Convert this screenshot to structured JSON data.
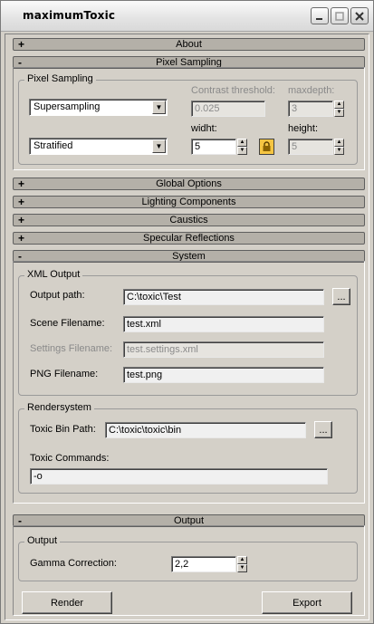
{
  "window": {
    "title": "maximumToxic"
  },
  "rollouts": {
    "about": {
      "sign": "+",
      "title": "About"
    },
    "pixel_sampling": {
      "sign": "-",
      "title": "Pixel Sampling"
    },
    "global_options": {
      "sign": "+",
      "title": "Global Options"
    },
    "lighting": {
      "sign": "+",
      "title": "Lighting Components"
    },
    "caustics": {
      "sign": "+",
      "title": "Caustics"
    },
    "specular": {
      "sign": "+",
      "title": "Specular Reflections"
    },
    "system": {
      "sign": "-",
      "title": "System"
    },
    "output": {
      "sign": "-",
      "title": "Output"
    }
  },
  "pixel_sampling": {
    "group": "Pixel Sampling",
    "sampling_mode": "Supersampling",
    "distribution": "Stratified",
    "contrast_label": "Contrast threshold:",
    "contrast_value": "0.025",
    "maxdepth_label": "maxdepth:",
    "maxdepth_value": "3",
    "width_label": "widht:",
    "width_value": "5",
    "height_label": "height:",
    "height_value": "5"
  },
  "xml_output": {
    "group": "XML Output",
    "output_path_label": "Output path:",
    "output_path": "C:\\toxic\\Test",
    "browse": "...",
    "scene_label": "Scene Filename:",
    "scene_value": "test.xml",
    "settings_label": "Settings Filename:",
    "settings_value": "test.settings.xml",
    "png_label": "PNG Filename:",
    "png_value": "test.png"
  },
  "rendersystem": {
    "group": "Rendersystem",
    "bin_label": "Toxic Bin Path:",
    "bin_value": "C:\\toxic\\toxic\\bin",
    "browse": "...",
    "commands_label": "Toxic Commands:",
    "commands_value": "-o"
  },
  "output": {
    "group": "Output",
    "gamma_label": "Gamma Correction:",
    "gamma_value": "2,2"
  },
  "actions": {
    "render": "Render",
    "export": "Export"
  }
}
